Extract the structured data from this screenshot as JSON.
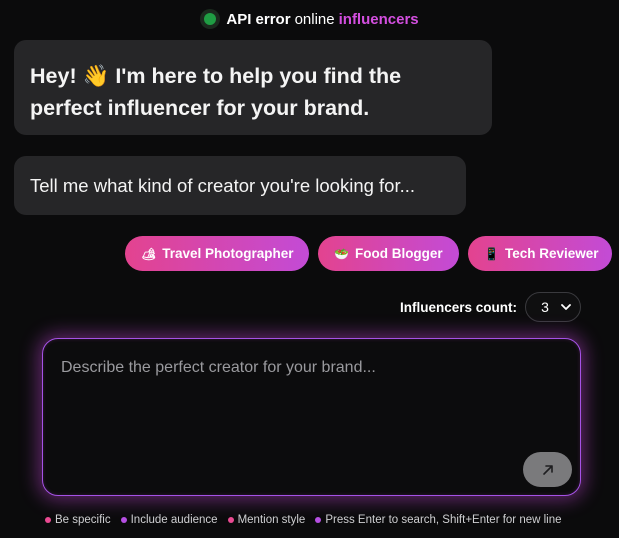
{
  "status": {
    "strong": "API error",
    "normal": "online",
    "accent": "influencers"
  },
  "messages": [
    {
      "text": "Hey! 👋 I'm here to help you find the perfect influencer for your brand."
    },
    {
      "text": "Tell me what kind of creator you're looking for..."
    }
  ],
  "suggestions": [
    {
      "emoji": "🏕",
      "label": "Travel Photographer"
    },
    {
      "emoji": "🥗",
      "label": "Food Blogger"
    },
    {
      "emoji": "📱",
      "label": "Tech Reviewer"
    }
  ],
  "count": {
    "label": "Influencers count:",
    "value": "3"
  },
  "input": {
    "placeholder": "Describe the perfect creator for your brand..."
  },
  "hints": [
    {
      "text": "Be specific",
      "color": "#ea4a92"
    },
    {
      "text": "Include audience",
      "color": "#b54fe2"
    },
    {
      "text": "Mention style",
      "color": "#ea4a92"
    },
    {
      "text": "Press Enter to search, Shift+Enter for new line",
      "color": "#b54fe2"
    }
  ],
  "colors": {
    "accent": "#d44fe0",
    "status_ok": "#1f9d43",
    "chip_start": "#e3438f",
    "chip_end": "#c34bd6"
  }
}
